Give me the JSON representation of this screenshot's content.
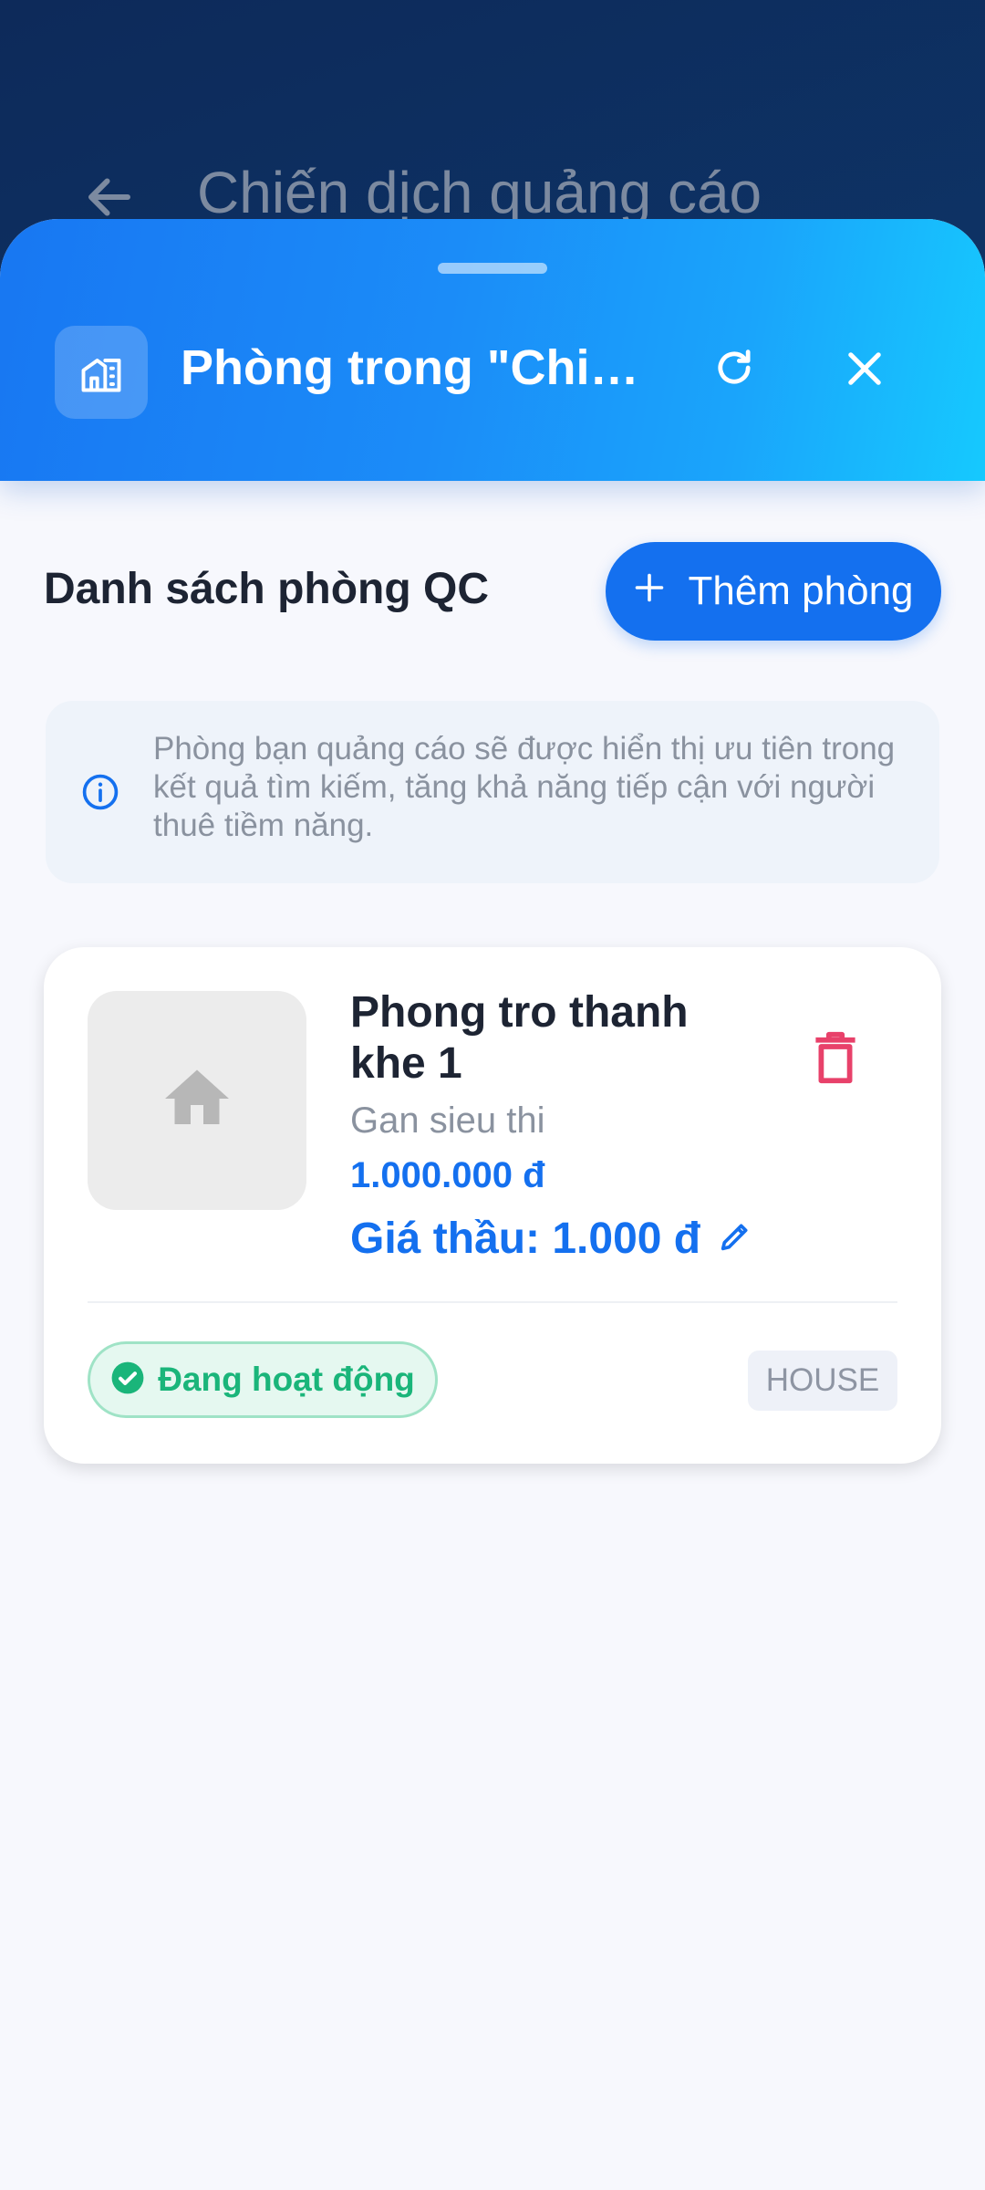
{
  "background_page": {
    "title": "Chiến dịch quảng cáo"
  },
  "sheet": {
    "title": "Phòng trong \"Chiến ...",
    "icons": {
      "header": "building-icon",
      "refresh": "refresh-icon",
      "close": "close-icon"
    }
  },
  "list": {
    "title": "Danh sách phòng QC",
    "add_label": "Thêm phòng"
  },
  "info": {
    "text": "Phòng bạn quảng cáo sẽ được hiển thị ưu tiên trong kết quả tìm kiếm, tăng khả năng tiếp cận với người thuê tiềm năng."
  },
  "rooms": [
    {
      "name": "Phong tro thanh khe 1",
      "description": "Gan sieu thi",
      "price": "1.000.000 đ",
      "bid": "Giá thầu: 1.000 đ",
      "status": "Đang hoạt động",
      "type": "HOUSE"
    }
  ],
  "colors": {
    "primary": "#1470ef",
    "header_gradient_start": "#1877f2",
    "header_gradient_end": "#16c9fe",
    "danger": "#e8416a",
    "success": "#1ab57a"
  }
}
